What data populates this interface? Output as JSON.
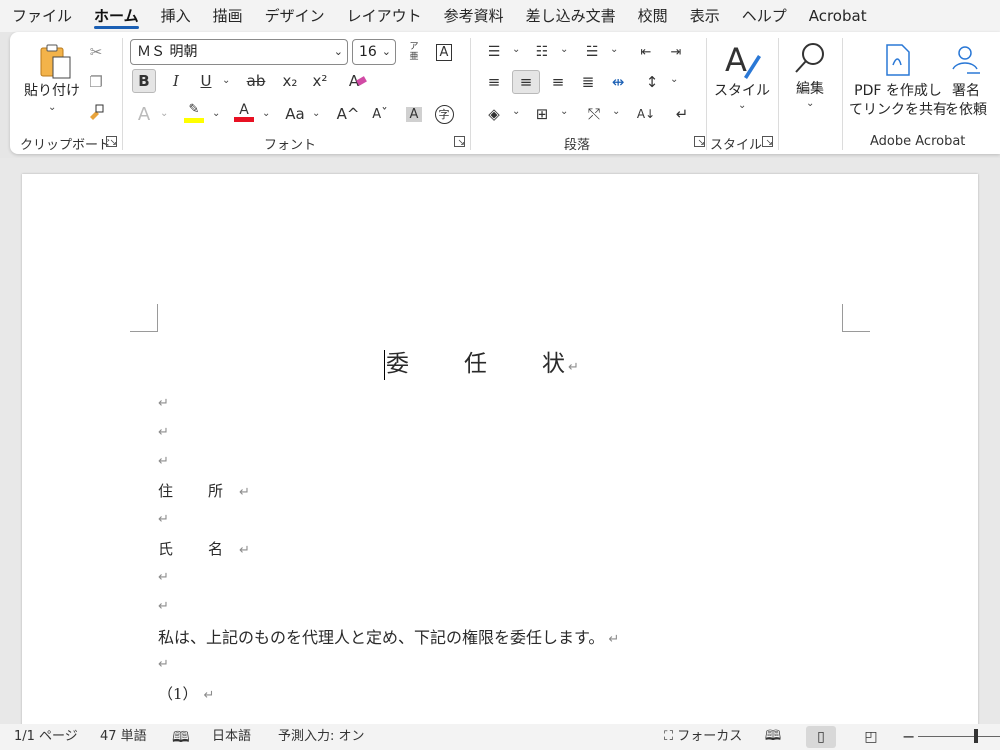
{
  "menu": {
    "items": [
      {
        "label": "ファイル",
        "active": false
      },
      {
        "label": "ホーム",
        "active": true
      },
      {
        "label": "挿入",
        "active": false
      },
      {
        "label": "描画",
        "active": false
      },
      {
        "label": "デザイン",
        "active": false
      },
      {
        "label": "レイアウト",
        "active": false
      },
      {
        "label": "参考資料",
        "active": false
      },
      {
        "label": "差し込み文書",
        "active": false
      },
      {
        "label": "校閲",
        "active": false
      },
      {
        "label": "表示",
        "active": false
      },
      {
        "label": "ヘルプ",
        "active": false
      },
      {
        "label": "Acrobat",
        "active": false
      }
    ]
  },
  "ribbon": {
    "clipboard": {
      "label": "クリップボード",
      "paste_label": "貼り付け"
    },
    "font": {
      "label": "フォント",
      "font_name": "ＭＳ 明朝",
      "font_size": "16",
      "bold": "B",
      "italic": "I",
      "underline": "U",
      "strike": "ab",
      "subscript": "x₂",
      "superscript": "x²",
      "change_case": "Aa",
      "grow": "A^",
      "shrink": "Aˇ",
      "ruby": "ア亜",
      "char_border": "A",
      "char_shade": "A",
      "enclose": "字",
      "text_effects": "A",
      "clear_format": "A",
      "highlight_color": "#ffff00",
      "font_color": "#e81123"
    },
    "paragraph": {
      "label": "段落"
    },
    "styles": {
      "label": "スタイル",
      "button_label": "スタイル"
    },
    "editing": {
      "button_label": "編集"
    },
    "acrobat": {
      "label": "Adobe Acrobat",
      "pdf_button": [
        "PDF を作成し",
        "てリンクを共有"
      ],
      "sign_button": [
        "署名",
        "を依頼"
      ]
    }
  },
  "document": {
    "title": "委　　任　　状",
    "lines": [
      {
        "kind": "field",
        "label": "住　所"
      },
      {
        "kind": "field",
        "label": "氏　名"
      }
    ],
    "body_sentence": "私は、上記のものを代理人と定め、下記の権限を委任します。",
    "item_1": "（1）",
    "return_mark": "↵"
  },
  "status": {
    "page": "1/1 ページ",
    "words": "47 単語",
    "language": "日本語",
    "ime": "予測入力: オン",
    "focus": "フォーカス"
  },
  "colors": {
    "accent": "#1a5fb4",
    "ribbon_bg": "#ffffff",
    "menubar_bg": "#f3f3f3"
  }
}
